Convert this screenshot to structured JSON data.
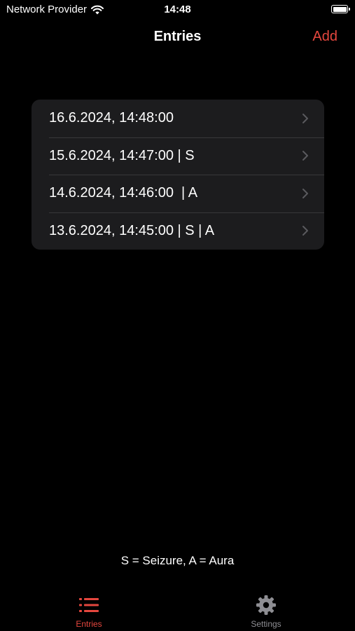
{
  "status_bar": {
    "carrier": "Network Provider",
    "time": "14:48",
    "wifi_icon": "wifi-icon",
    "battery_icon": "battery-icon"
  },
  "nav": {
    "title": "Entries",
    "add_label": "Add"
  },
  "entries": [
    {
      "label": "16.6.2024, 14:48:00"
    },
    {
      "label": "15.6.2024, 14:47:00 | S"
    },
    {
      "label": "14.6.2024, 14:46:00  | A"
    },
    {
      "label": "13.6.2024, 14:45:00 | S | A"
    }
  ],
  "legend": "S = Seizure, A = Aura",
  "tabs": [
    {
      "label": "Entries",
      "icon": "list-icon",
      "selected": true
    },
    {
      "label": "Settings",
      "icon": "gear-icon",
      "selected": false
    }
  ],
  "colors": {
    "accent": "#e5473e",
    "background": "#000000",
    "card": "#1c1c1e",
    "inactive": "#8e8e93"
  }
}
